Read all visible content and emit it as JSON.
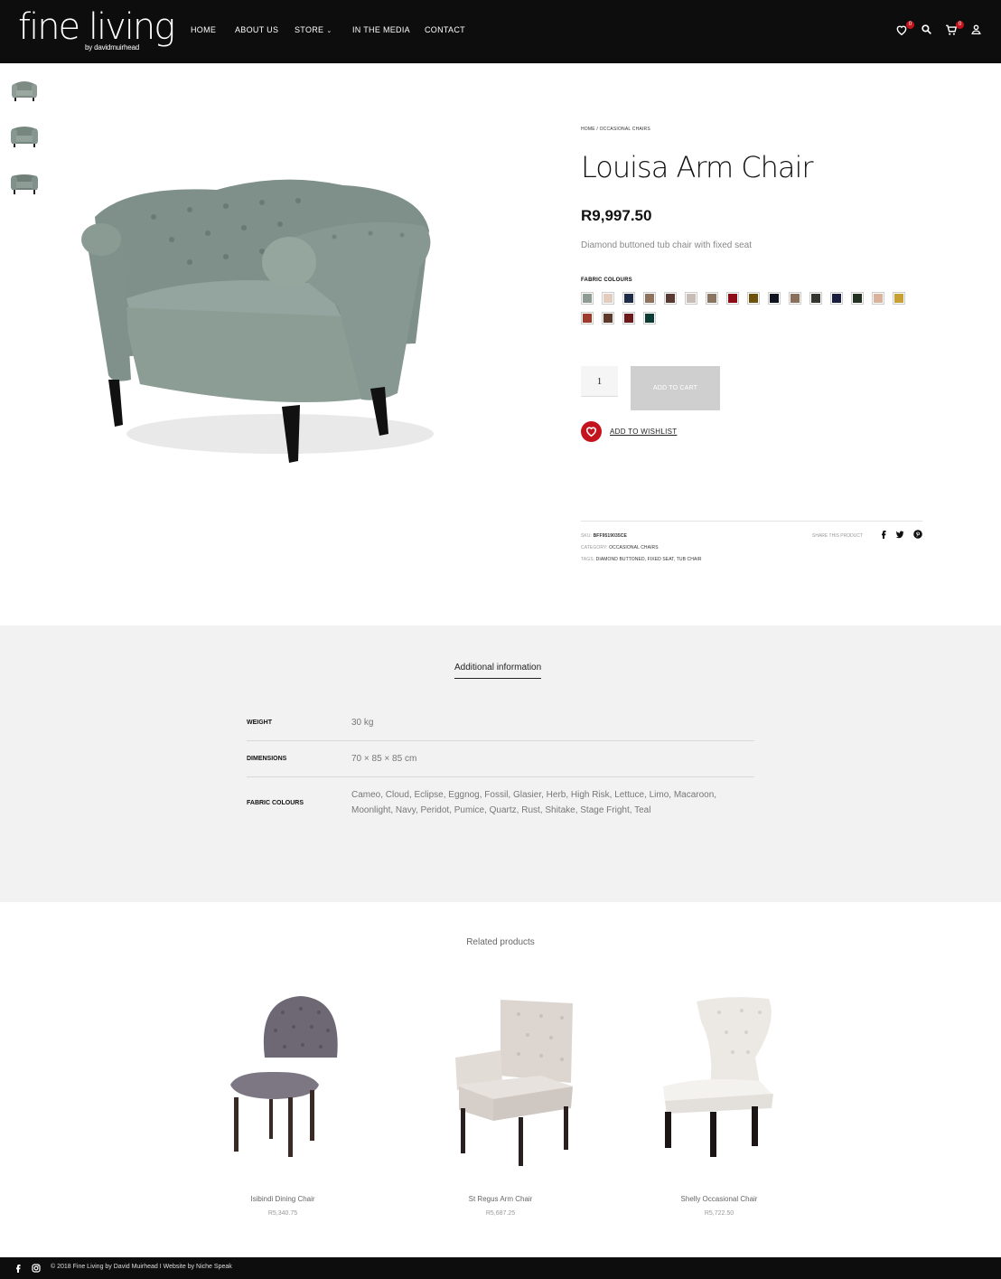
{
  "logo": {
    "main": "fine living",
    "sub": "by davidmuirhead"
  },
  "nav": {
    "home": "HOME",
    "about": "ABOUT US",
    "store": "STORE",
    "media": "IN THE MEDIA",
    "contact": "CONTACT"
  },
  "header_icons": {
    "wishlist_count": "0",
    "cart_count": "0"
  },
  "breadcrumb": {
    "home": "HOME",
    "sep": " / ",
    "category": "OCCASIONAL CHAIRS"
  },
  "product": {
    "title": "Louisa Arm Chair",
    "price": "R9,997.50",
    "short_description": "Diamond buttoned tub chair with fixed seat",
    "fabric_label": "FABRIC COLOURS",
    "quantity": "1",
    "add_to_cart": "ADD TO CART",
    "wishlist": "ADD TO WISHLIST",
    "swatch_colors": [
      "#8f9c93",
      "#e2ccbd",
      "#1e2d4a",
      "#8e725e",
      "#5a3a30",
      "#c7bcb6",
      "#8a7563",
      "#8e0c17",
      "#6e520c",
      "#0f1320",
      "#8a6f5b",
      "#34352f",
      "#1a1e3e",
      "#233122",
      "#d9b39b",
      "#c9a034",
      "#9e3b2c",
      "#5d3a2c",
      "#6e1a1c",
      "#0f3b35"
    ]
  },
  "meta": {
    "sku_label": "SKU:",
    "sku": "BFF9519035CE",
    "category_label": "CATEGORY:",
    "category": "OCCASIONAL CHAIRS",
    "tags_label": "TAGS:",
    "tags": "DIAMOND BUTTONED, FIXED SEAT, TUB CHAIR",
    "share_label": "SHARE THIS PRODUCT"
  },
  "additional_info": {
    "tab": "Additional information",
    "rows": [
      {
        "key": "WEIGHT",
        "value": "30 kg"
      },
      {
        "key": "DIMENSIONS",
        "value": "70 × 85 × 85 cm"
      },
      {
        "key": "FABRIC COLOURS",
        "value": "Cameo, Cloud, Eclipse, Eggnog, Fossil, Glasier, Herb, High Risk, Lettuce, Limo, Macaroon, Moonlight, Navy, Peridot, Pumice, Quartz, Rust, Shitake, Stage Fright, Teal"
      }
    ]
  },
  "related": {
    "title": "Related products",
    "items": [
      {
        "name": "Isibindi Dining Chair",
        "price": "R5,340.75"
      },
      {
        "name": "St Regus Arm Chair",
        "price": "R5,687.25"
      },
      {
        "name": "Shelly Occasional Chair",
        "price": "R5,722.50"
      }
    ]
  },
  "footer": {
    "text": "© 2018 Fine Living by David Muirhead I Website by Niche Speak"
  }
}
